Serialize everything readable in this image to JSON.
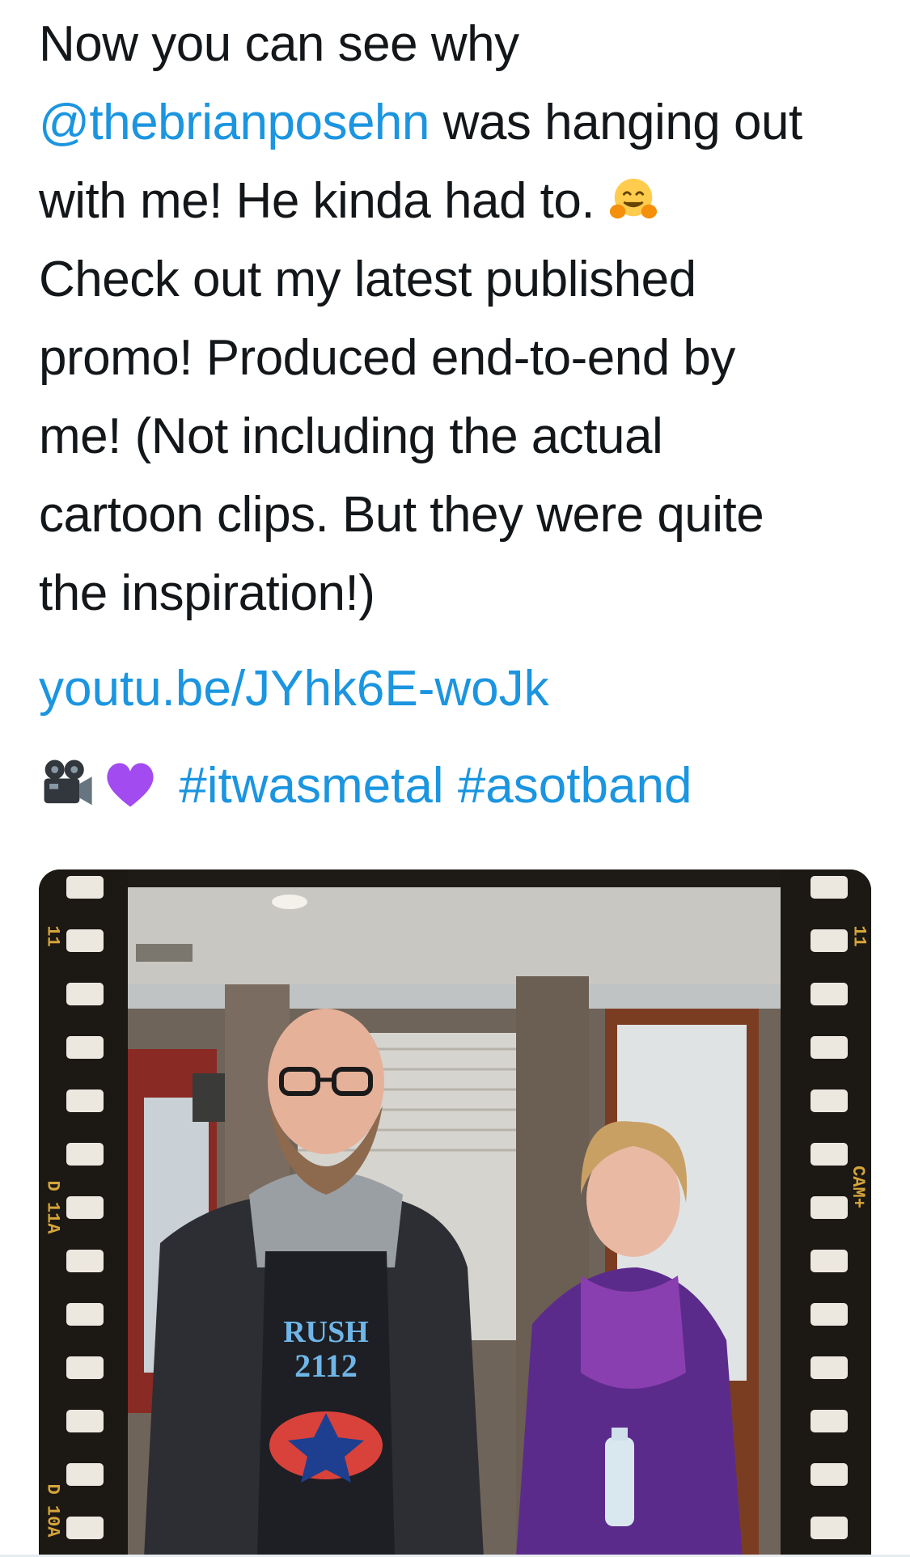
{
  "tweet": {
    "lines": [
      "Now you can see why",
      " was hanging out",
      "with me! He kinda had to. ",
      "Check out my latest published",
      "promo! Produced end-to-end by",
      "me! (Not including the actual",
      "cartoon clips. But they were quite",
      "the inspiration!)"
    ],
    "mention": "@thebrianposehn",
    "link": "youtu.be/JYhk6E-woJk",
    "hashtags": [
      "#itwasmetal",
      "#asotband"
    ],
    "emoji_icons": [
      "hugging-face-icon",
      "movie-camera-icon",
      "purple-heart-icon"
    ]
  },
  "media": {
    "film_edge_labels": [
      "11",
      "D 11A",
      "D 10A",
      "11",
      "CAM+"
    ],
    "shirt_text": [
      "RUSH",
      "2112"
    ]
  },
  "colors": {
    "link": "#1b95e0",
    "text": "#14171a",
    "film_border": "#1c1814",
    "sprocket": "#ece7df",
    "purple_heart": "#a24bf0"
  }
}
